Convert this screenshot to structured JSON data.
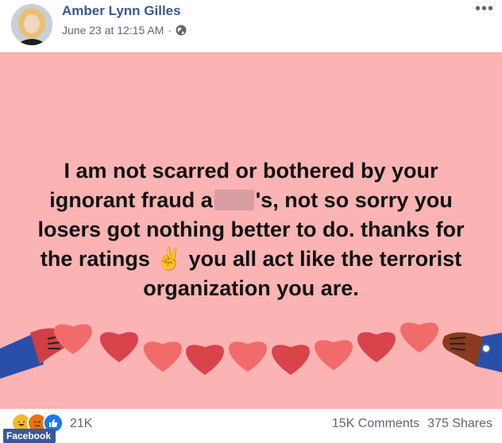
{
  "header": {
    "author_name": "Amber Lynn Gilles",
    "timestamp": "June 23 at 12:15 AM",
    "separator": "·",
    "privacy_icon": "globe-icon",
    "more_icon": "ellipsis-icon"
  },
  "post": {
    "background_color": "#fbb3b3",
    "text_before_redaction": "I am not scarred or bothered by your ignorant fraud a",
    "text_after_redaction": "'s, not so sorry you losers got nothing better to do. thanks for the ratings ",
    "emoji": "✌",
    "text_end": " you all act like the terrorist organization you are."
  },
  "footer": {
    "reaction_icons": [
      "laugh-icon",
      "angry-icon",
      "like-icon"
    ],
    "reaction_count": "21K",
    "comments": "15K Comments",
    "shares": "375 Shares"
  },
  "watermark": "Facebook"
}
